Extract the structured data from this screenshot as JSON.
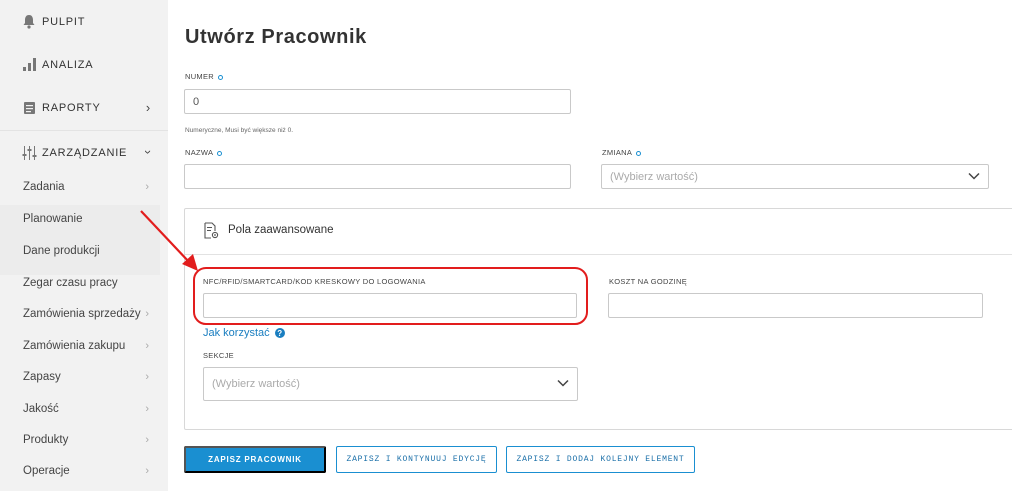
{
  "sidebar": {
    "top_items": [
      {
        "label": "PULPIT",
        "icon": "bell-icon"
      },
      {
        "label": "ANALIZA",
        "icon": "bar-chart-icon"
      },
      {
        "label": "RAPORTY",
        "icon": "report-icon"
      },
      {
        "label": "ZARZĄDZANIE",
        "icon": "sliders-icon"
      }
    ],
    "sub_items": [
      {
        "label": "Zadania"
      },
      {
        "label": "Planowanie"
      },
      {
        "label": "Dane produkcji"
      },
      {
        "label": "Zegar czasu pracy"
      },
      {
        "label": "Zamówienia sprzedaży"
      },
      {
        "label": "Zamówienia zakupu"
      },
      {
        "label": "Zapasy"
      },
      {
        "label": "Jakość"
      },
      {
        "label": "Produkty"
      },
      {
        "label": "Operacje"
      }
    ]
  },
  "page": {
    "title": "Utwórz Pracownik"
  },
  "form": {
    "numer": {
      "label": "NUMER",
      "value": "0",
      "hint": "Numeryczne, Musi być większe niż 0."
    },
    "nazwa": {
      "label": "NAZWA",
      "value": ""
    },
    "zmiana": {
      "label": "ZMIANA",
      "placeholder": "(Wybierz wartość)"
    },
    "advanced": {
      "title": "Pola zaawansowane",
      "nfc": {
        "label": "NFC/RFID/SMARTCARD/KOD KRESKOWY DO LOGOWANIA",
        "value": ""
      },
      "cost": {
        "label": "KOSZT NA GODZINĘ",
        "value": ""
      },
      "help_link": "Jak korzystać",
      "help_icon": "?",
      "sections": {
        "label": "SEKCJE",
        "placeholder": "(Wybierz wartość)"
      }
    }
  },
  "buttons": {
    "save": "ZAPISZ PRACOWNIK",
    "save_continue": "ZAPISZ I KONTYNUUJ EDYCJĘ",
    "save_add": "ZAPISZ I DODAJ KOLEJNY ELEMENT"
  },
  "colors": {
    "accent": "#1a8fd1",
    "annotation": "#e21d1d",
    "sidebar_bg": "#f2f2f2"
  }
}
